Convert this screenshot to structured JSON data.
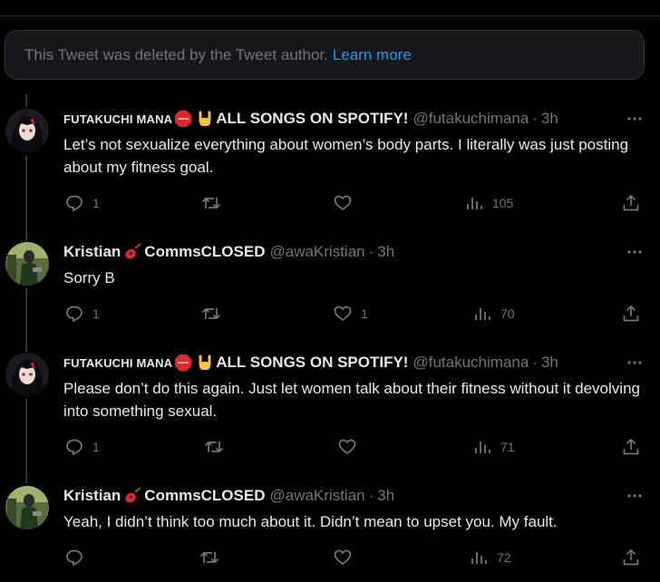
{
  "deleted_notice": {
    "text": "This Tweet was deleted by the Tweet author.",
    "link": "Learn more"
  },
  "tweets": [
    {
      "name_part1": "FUTAKUCHI MANA",
      "name_part2": "ALL SONGS ON SPOTIFY!",
      "handle": "@futakuchimana",
      "time": "3h",
      "text": "Let’s not sexualize everything about women’s body parts. I literally was just posting about my fitness goal.",
      "replies": "1",
      "retweets": "",
      "likes": "",
      "views": "105"
    },
    {
      "name_part1": "Kristian",
      "name_part2": "CommsCLOSED",
      "handle": "@awaKristian",
      "time": "3h",
      "text": "Sorry B",
      "replies": "1",
      "retweets": "",
      "likes": "1",
      "views": "70"
    },
    {
      "name_part1": "FUTAKUCHI MANA",
      "name_part2": "ALL SONGS ON SPOTIFY!",
      "handle": "@futakuchimana",
      "time": "3h",
      "text": "Please don’t do this again. Just let women talk about their fitness without it devolving into something sexual.",
      "replies": "1",
      "retweets": "",
      "likes": "",
      "views": "71"
    },
    {
      "name_part1": "Kristian",
      "name_part2": "CommsCLOSED",
      "handle": "@awaKristian",
      "time": "3h",
      "text": "Yeah, I didn’t think too much about it. Didn’t mean to upset you. My fault.",
      "replies": "",
      "retweets": "",
      "likes": "",
      "views": "72"
    }
  ],
  "separator": "·",
  "icons": [
    "reply-icon",
    "retweet-icon",
    "like-icon",
    "views-icon",
    "share-icon",
    "more-icon",
    "stop-sign-emoji",
    "rock-hand-emoji",
    "guitar-emoji"
  ],
  "colors": {
    "background": "#000000",
    "text": "#e7e9ea",
    "muted": "#71767b",
    "link": "#1d9bf0",
    "border": "#2f3336"
  }
}
